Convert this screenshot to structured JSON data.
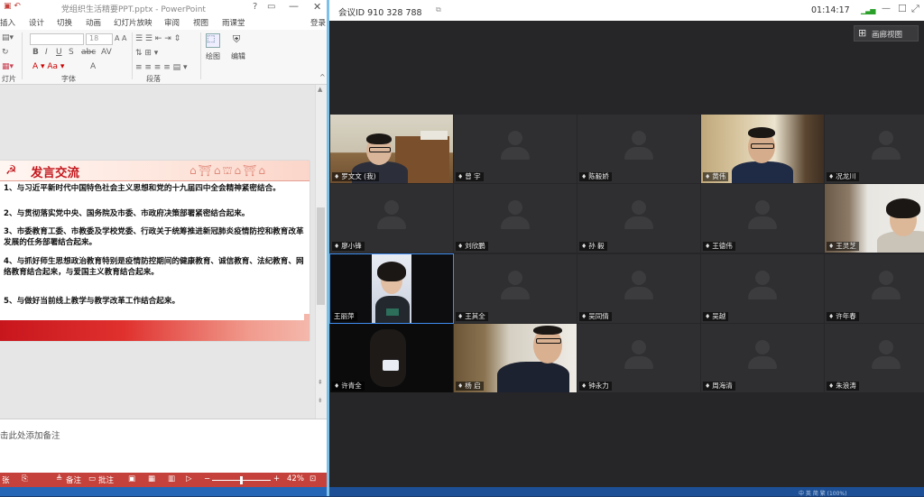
{
  "powerpoint": {
    "title": "党组织生活精要PPT.pptx - PowerPoint",
    "help_icon": "?",
    "window_buttons": {
      "minimize": "—",
      "close": "✕"
    },
    "tabs": [
      "插入",
      "设计",
      "切换",
      "动画",
      "幻灯片放映",
      "审阅",
      "视图",
      "雨课堂",
      "登录"
    ],
    "ribbon": {
      "font_size_value": "18",
      "groups": {
        "slides": "灯片",
        "font": "字体",
        "paragraph": "段落"
      },
      "buttons": {
        "draw": "绘图",
        "edit": "编辑"
      }
    },
    "slide": {
      "header_title": "发言交流",
      "items": [
        "1、与习近平新时代中国特色社会主义思想和党的十九届四中全会精神紧密结合。",
        "2、与贯彻落实党中央、国务院及市委、市政府决策部署紧密结合起来。",
        "3、市委教育工委、市教委及学校党委、行政关于统筹推进新冠肺炎疫情防控和教育改革发展的任务部署结合起来。",
        "4、与抓好师生思想政治教育特别是疫情防控期间的健康教育、诚信教育、法纪教育、网络教育结合起来，与爱国主义教育结合起来。",
        "5、与做好当前线上教学与教学改革工作结合起来。"
      ]
    },
    "notes_placeholder": "击此处添加备注",
    "status": {
      "slide_label": "张",
      "notes": "备注",
      "comments": "批注",
      "zoom": "42%",
      "zoom_percent": 42
    }
  },
  "meeting": {
    "meeting_id": "会议ID 910 328 788",
    "timer": "01:14:17",
    "signal_icon": "signal-bars-icon",
    "gallery_view_label": "画廊视图",
    "participants": [
      {
        "name": "罗文文 (我)",
        "video": true
      },
      {
        "name": "曾 宇",
        "video": false
      },
      {
        "name": "陈毅娇",
        "video": false
      },
      {
        "name": "黄伟",
        "video": true
      },
      {
        "name": "况龙川",
        "video": false
      },
      {
        "name": "廖小锋",
        "video": false
      },
      {
        "name": "刘欣鹏",
        "video": false
      },
      {
        "name": "孙 毅",
        "video": false
      },
      {
        "name": "王德伟",
        "video": false
      },
      {
        "name": "王灵芝",
        "video": true
      },
      {
        "name": "王丽萍",
        "video": true
      },
      {
        "name": "王其全",
        "video": false
      },
      {
        "name": "吴同倩",
        "video": false
      },
      {
        "name": "吴越",
        "video": false
      },
      {
        "name": "许年春",
        "video": false
      },
      {
        "name": "许青全",
        "video": true
      },
      {
        "name": "杨 启",
        "video": true
      },
      {
        "name": "钟永力",
        "video": false
      },
      {
        "name": "周海清",
        "video": false
      },
      {
        "name": "朱浪涛",
        "video": false
      }
    ]
  },
  "taskbar": {
    "ime_text": "中 英 简 繁 (100%)"
  }
}
